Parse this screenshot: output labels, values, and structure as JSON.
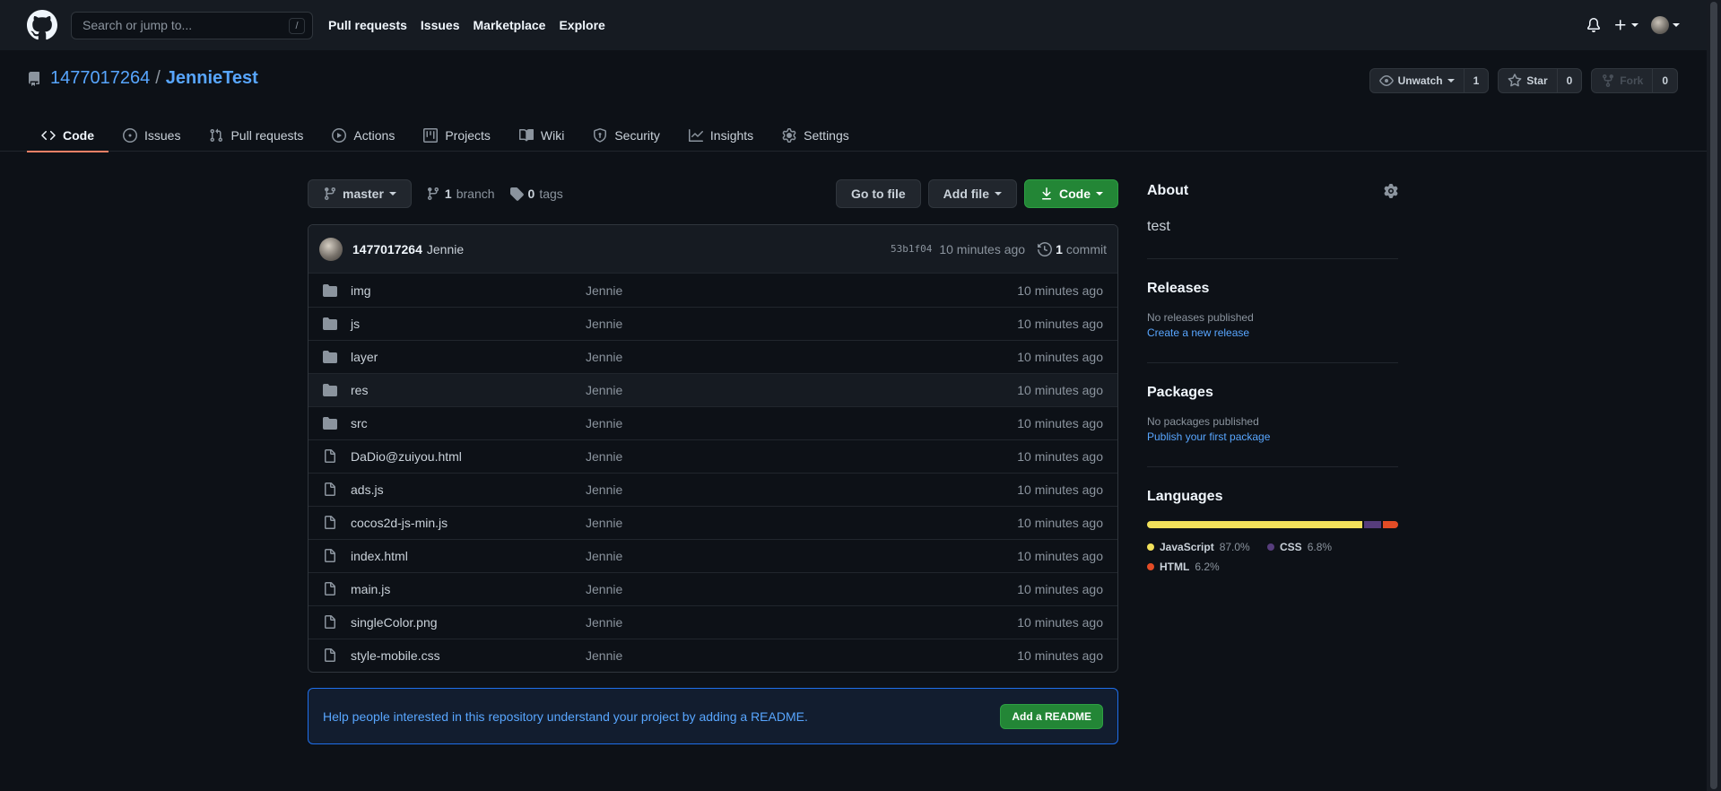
{
  "header": {
    "search_placeholder": "Search or jump to...",
    "search_shortcut": "/",
    "nav": [
      "Pull requests",
      "Issues",
      "Marketplace",
      "Explore"
    ]
  },
  "repo": {
    "owner": "1477017264",
    "separator": "/",
    "name": "JennieTest",
    "watch_label": "Unwatch",
    "watch_count": "1",
    "star_label": "Star",
    "star_count": "0",
    "fork_label": "Fork",
    "fork_count": "0"
  },
  "tabs": [
    {
      "label": "Code",
      "icon": "code-icon",
      "selected": true
    },
    {
      "label": "Issues",
      "icon": "issue-icon"
    },
    {
      "label": "Pull requests",
      "icon": "pull-request-icon"
    },
    {
      "label": "Actions",
      "icon": "play-icon"
    },
    {
      "label": "Projects",
      "icon": "project-icon"
    },
    {
      "label": "Wiki",
      "icon": "book-icon"
    },
    {
      "label": "Security",
      "icon": "shield-icon"
    },
    {
      "label": "Insights",
      "icon": "graph-icon"
    },
    {
      "label": "Settings",
      "icon": "gear-icon"
    }
  ],
  "filenav": {
    "branch": "master",
    "branch_count": "1",
    "branch_label": "branch",
    "tag_count": "0",
    "tag_label": "tags",
    "goto_file": "Go to file",
    "add_file": "Add file",
    "code": "Code"
  },
  "commit": {
    "author": "1477017264",
    "message": "Jennie",
    "sha": "53b1f04",
    "age": "10 minutes ago",
    "count": "1",
    "count_label": "commit"
  },
  "files": [
    {
      "type": "dir",
      "name": "img",
      "commit": "Jennie",
      "age": "10 minutes ago"
    },
    {
      "type": "dir",
      "name": "js",
      "commit": "Jennie",
      "age": "10 minutes ago"
    },
    {
      "type": "dir",
      "name": "layer",
      "commit": "Jennie",
      "age": "10 minutes ago"
    },
    {
      "type": "dir",
      "name": "res",
      "commit": "Jennie",
      "age": "10 minutes ago"
    },
    {
      "type": "dir",
      "name": "src",
      "commit": "Jennie",
      "age": "10 minutes ago"
    },
    {
      "type": "file",
      "name": "DaDio@zuiyou.html",
      "commit": "Jennie",
      "age": "10 minutes ago"
    },
    {
      "type": "file",
      "name": "ads.js",
      "commit": "Jennie",
      "age": "10 minutes ago"
    },
    {
      "type": "file",
      "name": "cocos2d-js-min.js",
      "commit": "Jennie",
      "age": "10 minutes ago"
    },
    {
      "type": "file",
      "name": "index.html",
      "commit": "Jennie",
      "age": "10 minutes ago"
    },
    {
      "type": "file",
      "name": "main.js",
      "commit": "Jennie",
      "age": "10 minutes ago"
    },
    {
      "type": "file",
      "name": "singleColor.png",
      "commit": "Jennie",
      "age": "10 minutes ago"
    },
    {
      "type": "file",
      "name": "style-mobile.css",
      "commit": "Jennie",
      "age": "10 minutes ago"
    }
  ],
  "readme": {
    "text": "Help people interested in this repository understand your project by adding a README.",
    "button": "Add a README"
  },
  "sidebar": {
    "about_title": "About",
    "description": "test",
    "releases_title": "Releases",
    "releases_none": "No releases published",
    "releases_link": "Create a new release",
    "packages_title": "Packages",
    "packages_none": "No packages published",
    "packages_link": "Publish your first package",
    "languages_title": "Languages",
    "languages": [
      {
        "name": "JavaScript",
        "pct": "87.0%",
        "value": 87.0,
        "color": "#f1e05a"
      },
      {
        "name": "CSS",
        "pct": "6.8%",
        "value": 6.8,
        "color": "#563d7c"
      },
      {
        "name": "HTML",
        "pct": "6.2%",
        "value": 6.2,
        "color": "#e34c26"
      }
    ]
  }
}
